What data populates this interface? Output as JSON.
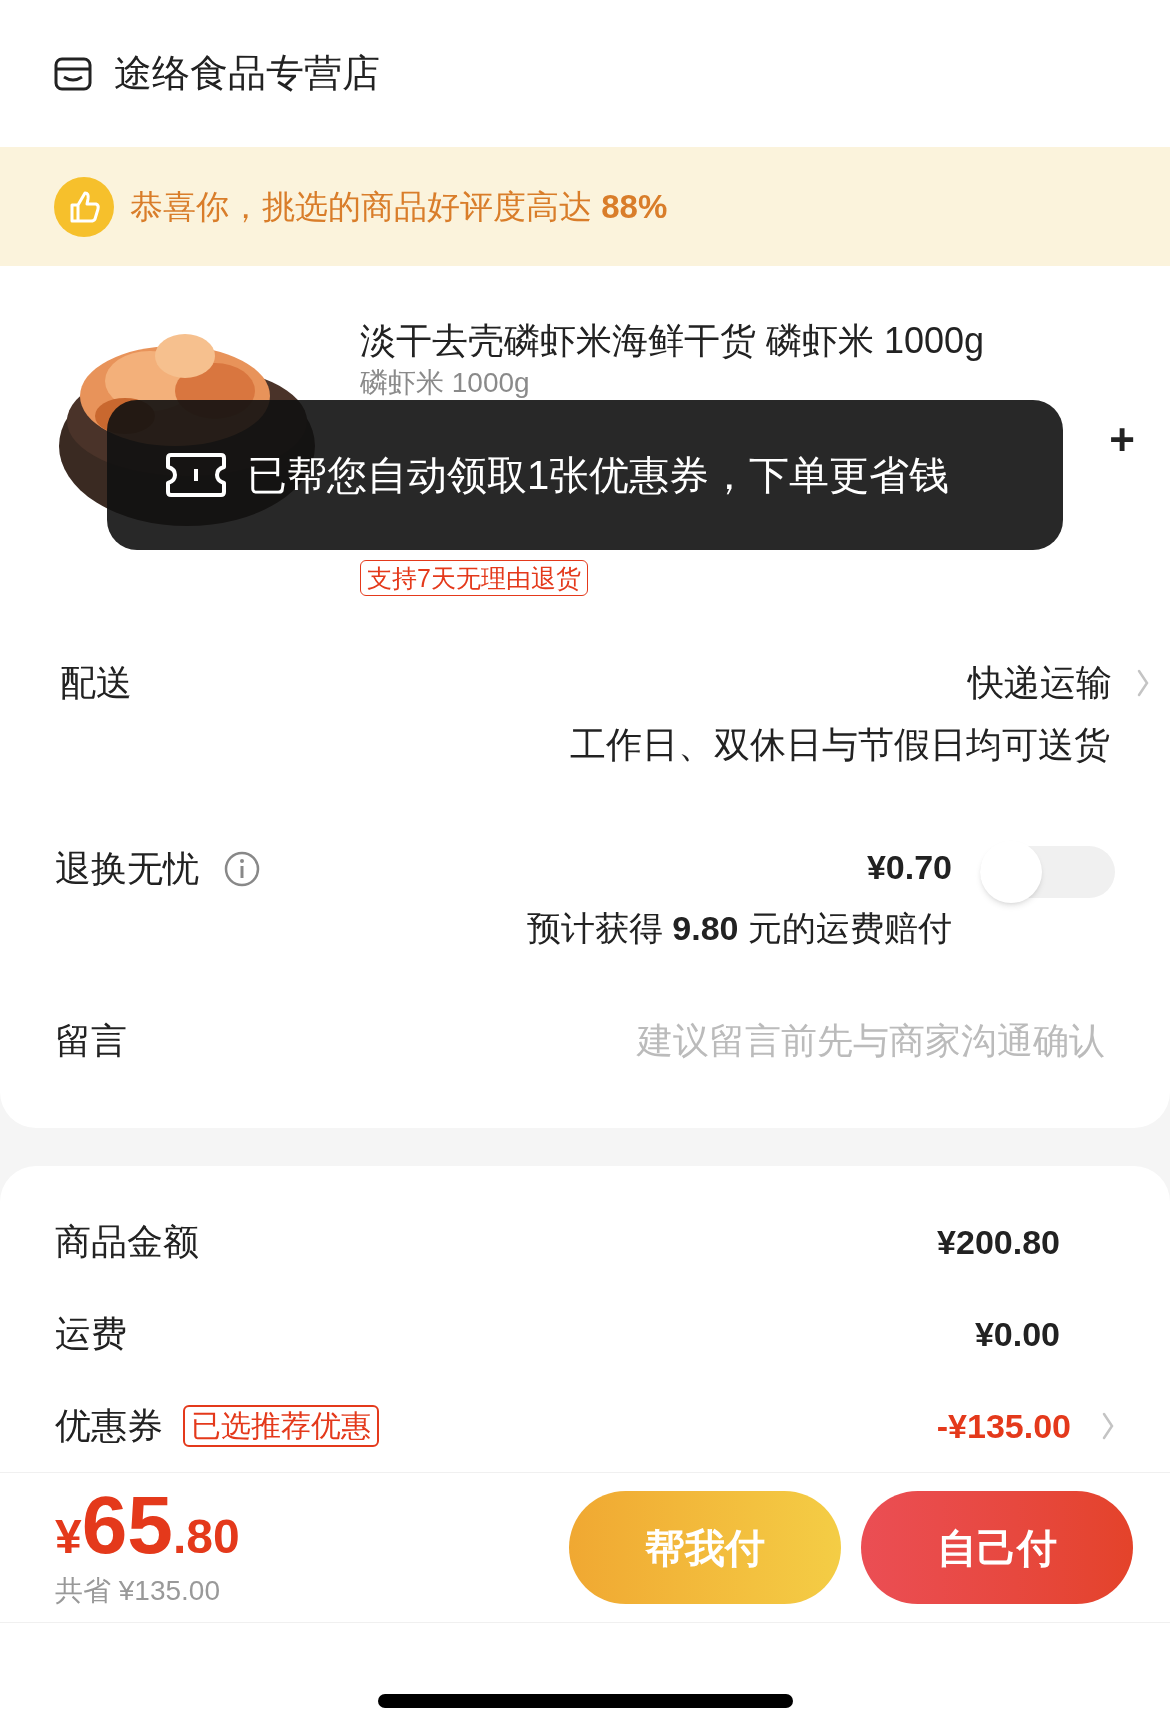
{
  "store": {
    "name": "途络食品专营店"
  },
  "banner": {
    "text": "恭喜你，挑选的商品好评度高达 **88%**"
  },
  "product": {
    "title": "淡干去壳磷虾米海鲜干货 磷虾米 1000g",
    "spec": "磷虾米 1000g",
    "plus": "+",
    "badge": "支持7天无理由退货"
  },
  "toast": {
    "text": "已帮您自动领取1张优惠券，下单更省钱"
  },
  "delivery": {
    "label": "配送",
    "value": "快递运输",
    "note": "工作日、双休日与节假日均可送货"
  },
  "return_insurance": {
    "label": "退换无忧",
    "price": "¥0.70",
    "note": "预计获得 **9.80** 元的运费赔付",
    "on": false
  },
  "message": {
    "label": "留言",
    "placeholder": "建议留言前先与商家沟通确认"
  },
  "summary": [
    {
      "label": "商品金额",
      "value": "¥200.80",
      "kind": "plain"
    },
    {
      "label": "运费",
      "value": "¥0.00",
      "kind": "plain"
    },
    {
      "label": "优惠券",
      "tag": "已选推荐优惠",
      "value": "-¥135.00",
      "kind": "discount"
    }
  ],
  "footer": {
    "currency": "¥",
    "integer": "65",
    "decimal": ".80",
    "saved": "共省 ¥135.00",
    "buttons": [
      {
        "label": "帮我付",
        "kind": "secondary"
      },
      {
        "label": "自己付",
        "kind": "primary"
      }
    ]
  }
}
